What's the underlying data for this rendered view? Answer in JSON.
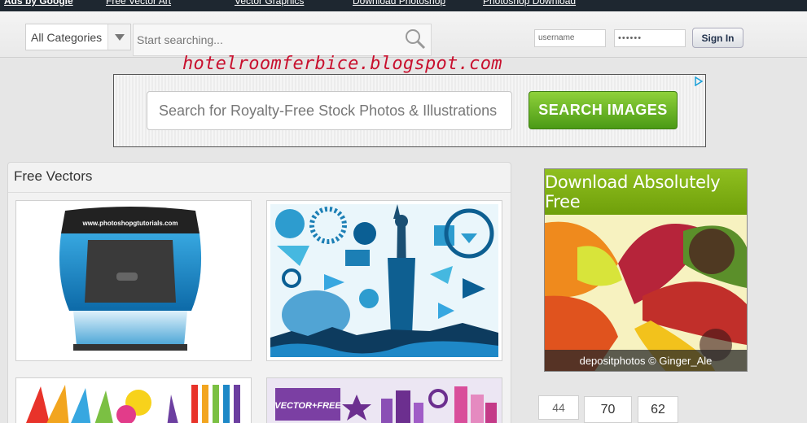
{
  "topnav": {
    "links": [
      "Ads by Google",
      "Free Vector Art",
      "Vector Graphics",
      "Download Photoshop",
      "Photoshop Download"
    ]
  },
  "header": {
    "category_label": "All Categories",
    "search_placeholder": "Start searching...",
    "username_value": "username",
    "password_value": "••••••",
    "signin_label": "Sign In"
  },
  "watermark": "hotelroomferbice.blogspot.com",
  "ad_banner": {
    "search_placeholder": "Search for Royalty-Free Stock Photos & Illustrations",
    "button_label": "SEARCH IMAGES"
  },
  "panel": {
    "title": "Free Vectors",
    "thumb_text": {
      "stamp_url": "www.photoshopgtutorials.com",
      "vector_free": "VECTOR+FREE"
    }
  },
  "side_ad": {
    "headline": "Download Absolutely Free",
    "caption": "depositphotos © Ginger_Ale"
  },
  "counters": [
    "44",
    "70",
    "62"
  ],
  "colors": {
    "topbar": "#1e2730",
    "ad_button": "#5aad1e",
    "watermark": "#c8102e",
    "side_ad_head": "#7fae12"
  }
}
